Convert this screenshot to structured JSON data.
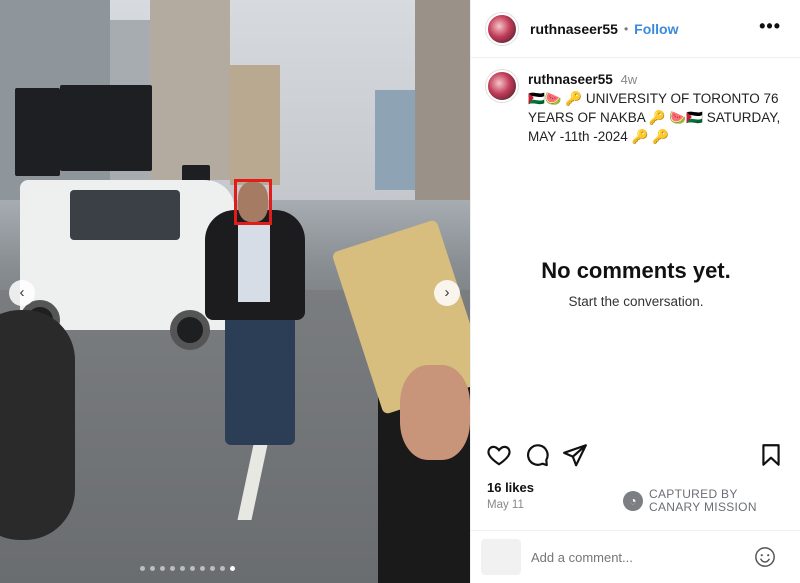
{
  "post": {
    "username": "ruthnaseer55",
    "follow_label": "Follow",
    "separator": "•",
    "more_label": "•••",
    "caption_user": "ruthnaseer55",
    "caption_time": "4w",
    "caption_text": "🇵🇸🍉 🔑 UNIVERSITY OF TORONTO 76 YEARS OF NAKBA 🔑 🍉🇵🇸 SATURDAY, MAY -11th -2024 🔑 🔑",
    "empty_title": "No comments yet.",
    "empty_sub": "Start the conversation.",
    "likes": "16 likes",
    "date": "May 11",
    "comment_placeholder": "Add a comment..."
  },
  "watermark": {
    "line1": "CAPTURED BY",
    "line2": "CANARY MISSION"
  },
  "carousel": {
    "prev_label": "‹",
    "next_label": "›",
    "dot_count": 10,
    "active_dot": 9
  },
  "colors": {
    "follow": "#3a8ae0",
    "face_box": "#e21b1b"
  }
}
